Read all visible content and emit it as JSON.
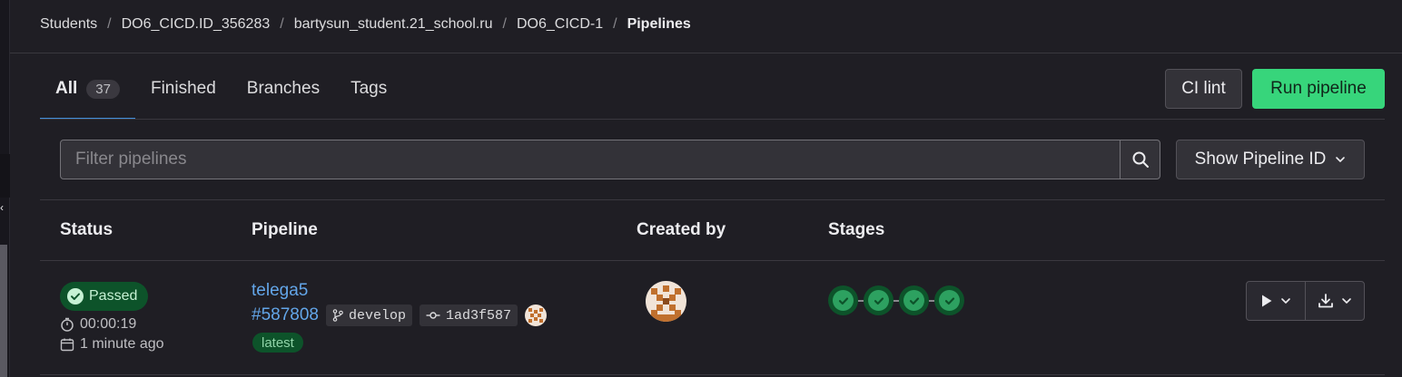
{
  "breadcrumb": {
    "items": [
      "Students",
      "DO6_CICD.ID_356283",
      "bartysun_student.21_school.ru",
      "DO6_CICD-1"
    ],
    "current": "Pipelines"
  },
  "tabs": {
    "all_label": "All",
    "all_count": "37",
    "finished_label": "Finished",
    "branches_label": "Branches",
    "tags_label": "Tags"
  },
  "buttons": {
    "ci_lint": "CI lint",
    "run_pipeline": "Run pipeline",
    "show_pipeline_id": "Show Pipeline ID"
  },
  "filter": {
    "placeholder": "Filter pipelines",
    "value": ""
  },
  "table": {
    "headers": [
      "Status",
      "Pipeline",
      "Created by",
      "Stages"
    ],
    "rows": [
      {
        "status": "Passed",
        "duration": "00:00:19",
        "finished": "1 minute ago",
        "name": "telega5",
        "id": "#587808",
        "branch": "develop",
        "commit": "1ad3f587",
        "tag": "latest",
        "stage_count": 4
      }
    ]
  },
  "icons": {
    "search": "search-icon",
    "chevron": "chevron-down-icon",
    "status": "check-circle-icon",
    "timer": "timer-icon",
    "calendar": "calendar-icon",
    "branch": "branch-icon",
    "commit": "commit-icon",
    "play": "play-icon",
    "download": "download-icon"
  },
  "colors": {
    "background": "#1f1e24",
    "link": "#63a6e9",
    "success_bg": "#0d532a",
    "success": "#2da160",
    "primary_button": "#37d57b"
  }
}
